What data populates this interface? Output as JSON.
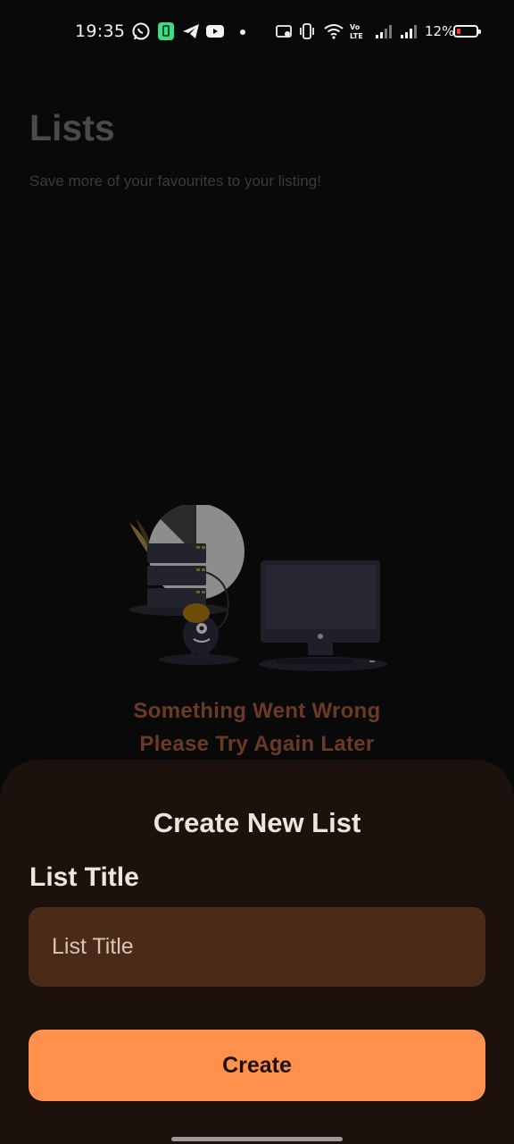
{
  "status_bar": {
    "time": "19:35",
    "battery_percent": "12%",
    "icons": [
      "whatsapp-icon",
      "battery-saver-icon",
      "telegram-icon",
      "youtube-icon",
      "dot-icon",
      "screen-record-icon",
      "vibrate-icon",
      "wifi-icon",
      "volte-icon",
      "signal-icon",
      "signal-icon"
    ]
  },
  "page": {
    "title": "Lists",
    "subtitle": "Save more of your favourites to your listing!"
  },
  "error": {
    "line1": "Something Went Wrong",
    "line2": "Please Try Again Later"
  },
  "sheet": {
    "title": "Create New List",
    "field_label": "List Title",
    "input_placeholder": "List Title",
    "input_value": "",
    "create_label": "Create"
  },
  "colors": {
    "background": "#090909",
    "sheet": "#1c110c",
    "input": "#4a2b18",
    "accent": "#ff914d",
    "error_text": "#6b3a26"
  }
}
